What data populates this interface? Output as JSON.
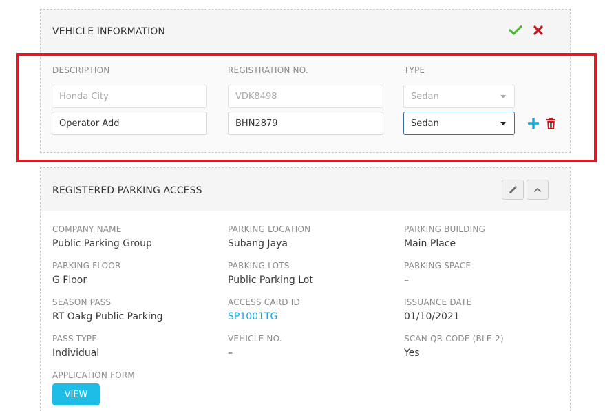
{
  "vehicle_section": {
    "title": "VEHICLE INFORMATION",
    "col_description": "DESCRIPTION",
    "col_registration": "REGISTRATION NO.",
    "col_type": "TYPE",
    "existing_row": {
      "description_placeholder": "Honda City",
      "registration_placeholder": "VDK8498",
      "type_value": "Sedan"
    },
    "new_row": {
      "description": "Operator Add",
      "registration": "BHN2879",
      "type_value": "Sedan"
    }
  },
  "parking_section": {
    "title": "REGISTERED PARKING ACCESS",
    "fields": {
      "company_name": {
        "label": "COMPANY NAME",
        "value": "Public Parking Group"
      },
      "parking_location": {
        "label": "PARKING LOCATION",
        "value": "Subang Jaya"
      },
      "parking_building": {
        "label": "PARKING BUILDING",
        "value": "Main Place"
      },
      "parking_floor": {
        "label": "PARKING FLOOR",
        "value": "G Floor"
      },
      "parking_lots": {
        "label": "PARKING LOTS",
        "value": "Public Parking Lot"
      },
      "parking_space": {
        "label": "PARKING SPACE",
        "value": "–"
      },
      "season_pass": {
        "label": "SEASON PASS",
        "value": "RT Oakg Public Parking"
      },
      "access_card_id": {
        "label": "ACCESS CARD ID",
        "value": "SP1001TG"
      },
      "issuance_date": {
        "label": "ISSUANCE DATE",
        "value": "01/10/2021"
      },
      "pass_type": {
        "label": "PASS TYPE",
        "value": "Individual"
      },
      "vehicle_no": {
        "label": "VEHICLE NO.",
        "value": "–"
      },
      "scan_qr_code": {
        "label": "SCAN QR CODE (BLE-2)",
        "value": "Yes"
      },
      "application_form": {
        "label": "APPLICATION FORM"
      }
    },
    "view_button": "VIEW"
  },
  "colors": {
    "accent_blue": "#1ebde8",
    "confirm_green": "#4cbb2f",
    "cancel_red": "#c4161c",
    "highlight_red": "#d3202a",
    "link_blue": "#1ba4d6"
  },
  "icons": [
    "check-icon",
    "close-icon",
    "plus-icon",
    "trash-icon",
    "pencil-icon",
    "chevron-up-icon",
    "caret-down-icon"
  ]
}
